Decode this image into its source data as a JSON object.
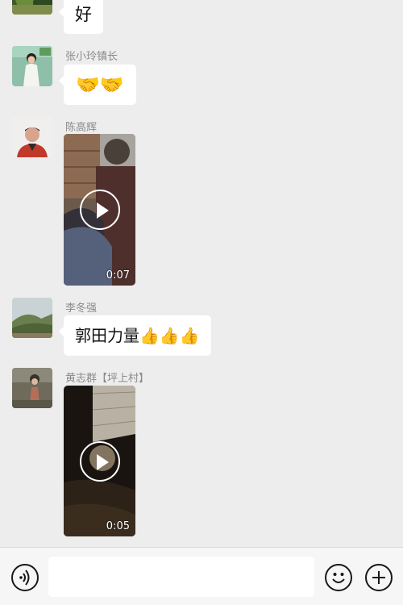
{
  "messages": [
    {
      "type": "text",
      "text": "好"
    },
    {
      "type": "text",
      "sender": "张小玲镇长",
      "text": "🤝🤝"
    },
    {
      "type": "video",
      "sender": "陈高辉",
      "duration": "0:07"
    },
    {
      "type": "text",
      "sender": "李冬强",
      "text": "郭田力量👍👍👍"
    },
    {
      "type": "video",
      "sender": "黄志群【坪上村】",
      "duration": "0:05"
    }
  ],
  "input_bar": {
    "voice_icon": "voice-icon",
    "emoji_icon": "emoji-icon",
    "plus_icon": "plus-icon",
    "text_value": ""
  },
  "colors": {
    "background": "#ededed",
    "bubble": "#ffffff",
    "sender_name": "#8a8a8a",
    "input_bar": "#f6f6f6"
  }
}
